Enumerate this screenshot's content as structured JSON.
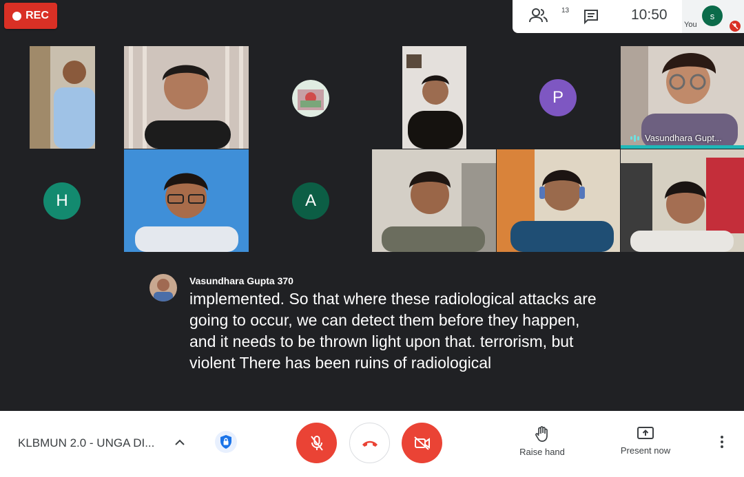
{
  "recording": {
    "label": "REC"
  },
  "top": {
    "participant_count": "13",
    "time": "10:50",
    "self_initial": "s",
    "self_label": "You"
  },
  "participants": [
    {
      "kind": "video",
      "tone": "#c9c2b4"
    },
    {
      "kind": "video",
      "tone": "#b8b0a6"
    },
    {
      "kind": "avatar-photo",
      "tone": "#d6e4d8"
    },
    {
      "kind": "video",
      "tone": "#ddd8d0"
    },
    {
      "kind": "initial",
      "initial": "P",
      "color": "#7e57c2"
    },
    {
      "kind": "video",
      "name": "Vasundhara Gupt...",
      "tone": "#9a8880"
    },
    {
      "kind": "initial",
      "initial": "H",
      "color": "#138a6f"
    },
    {
      "kind": "video",
      "tone": "#3f8fd8"
    },
    {
      "kind": "initial",
      "initial": "A",
      "color": "#0c5e45"
    },
    {
      "kind": "video",
      "tone": "#c8c2b4"
    },
    {
      "kind": "video",
      "tone": "#d9833a"
    },
    {
      "kind": "video",
      "tone": "#d6d0c2"
    }
  ],
  "caption": {
    "speaker": "Vasundhara Gupta 370",
    "text": "implemented. So that where these radiological attacks are going to occur, we can detect them before they happen, and it needs to be thrown light upon that. terrorism, but violent There has been ruins of radiological"
  },
  "bottom": {
    "meeting_title": "KLBMUN 2.0 - UNGA DI...",
    "raise_hand_label": "Raise hand",
    "present_now_label": "Present now"
  },
  "colors": {
    "danger": "#ea4335",
    "background": "#202124",
    "speaking": "#1fb8b8"
  }
}
